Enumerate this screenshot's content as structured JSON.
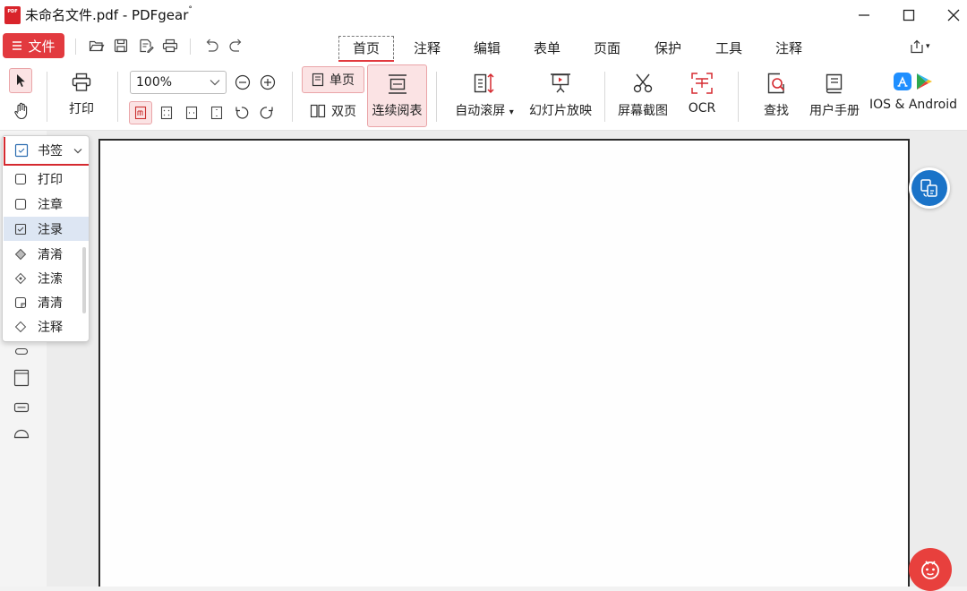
{
  "titlebar": {
    "logo_text": "PDF",
    "title": "未命名文件.pdf - PDFgear",
    "title_suffix": "°"
  },
  "menubar": {
    "file_label": "文件",
    "tabs": [
      {
        "label": "首页",
        "active": true
      },
      {
        "label": "注释",
        "active": false
      },
      {
        "label": "编辑",
        "active": false
      },
      {
        "label": "表单",
        "active": false
      },
      {
        "label": "页面",
        "active": false
      },
      {
        "label": "保护",
        "active": false
      },
      {
        "label": "工具",
        "active": false
      },
      {
        "label": "注释",
        "active": false
      }
    ],
    "share_caret": "▾"
  },
  "ribbon": {
    "print_label": "打印",
    "zoom_value": "100%",
    "single_page_label": "单页",
    "double_page_label": "双页",
    "continuous_label": "连续阅表",
    "auto_scroll_label": "自动滚屏",
    "auto_scroll_caret": "▾",
    "slideshow_label": "幻灯片放映",
    "screenshot_label": "屏幕截图",
    "ocr_label": "OCR",
    "find_label": "查找",
    "manual_label": "用户手册",
    "mobile_label": "IOS & Android"
  },
  "sidebar_dropdown": {
    "header_label": "书签",
    "items": [
      {
        "label": "打印"
      },
      {
        "label": "注章"
      },
      {
        "label": "注录",
        "selected": true
      },
      {
        "label": "清淆"
      },
      {
        "label": "注溹"
      },
      {
        "label": "清清"
      },
      {
        "label": "注释"
      }
    ]
  },
  "colors": {
    "accent_red": "#e23a3f",
    "fab_blue": "#1a73c8",
    "fab_red": "#e8403d",
    "selected_blue": "#dde6f3"
  }
}
